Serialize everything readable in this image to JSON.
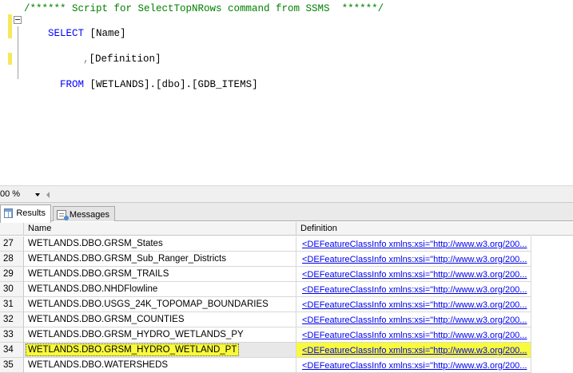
{
  "editor": {
    "comment": "/****** Script for SelectTopNRows command from SSMS  ******/",
    "line1": {
      "keyword": "SELECT",
      "rest": " [Name]"
    },
    "line2": {
      "comma": ",",
      "rest": "[Definition]"
    },
    "line3": {
      "keyword": "FROM",
      "rest": " [WETLANDS].[dbo].[GDB_ITEMS]"
    }
  },
  "zoom": {
    "value": "00 %"
  },
  "tabs": [
    {
      "label": "Results",
      "icon": "grid-icon",
      "active": true
    },
    {
      "label": "Messages",
      "icon": "messages-icon",
      "active": false
    }
  ],
  "grid": {
    "columns": [
      "Name",
      "Definition"
    ],
    "rows": [
      {
        "num": "27",
        "name": "WETLANDS.DBO.GRSM_States",
        "definition": "<DEFeatureClassInfo xmlns:xsi=\"http://www.w3.org/200..."
      },
      {
        "num": "28",
        "name": "WETLANDS.DBO.GRSM_Sub_Ranger_Districts",
        "definition": "<DEFeatureClassInfo xmlns:xsi=\"http://www.w3.org/200..."
      },
      {
        "num": "29",
        "name": "WETLANDS.DBO.GRSM_TRAILS",
        "definition": "<DEFeatureClassInfo xmlns:xsi=\"http://www.w3.org/200..."
      },
      {
        "num": "30",
        "name": "WETLANDS.DBO.NHDFlowline",
        "definition": "<DEFeatureClassInfo xmlns:xsi=\"http://www.w3.org/200..."
      },
      {
        "num": "31",
        "name": "WETLANDS.DBO.USGS_24K_TOPOMAP_BOUNDARIES",
        "definition": "<DEFeatureClassInfo xmlns:xsi=\"http://www.w3.org/200..."
      },
      {
        "num": "32",
        "name": "WETLANDS.DBO.GRSM_COUNTIES",
        "definition": "<DEFeatureClassInfo xmlns:xsi=\"http://www.w3.org/200..."
      },
      {
        "num": "33",
        "name": "WETLANDS.DBO.GRSM_HYDRO_WETLANDS_PY",
        "definition": "<DEFeatureClassInfo xmlns:xsi=\"http://www.w3.org/200..."
      },
      {
        "num": "34",
        "name": "WETLANDS.DBO.GRSM_HYDRO_WETLAND_PT",
        "definition": "<DEFeatureClassInfo xmlns:xsi=\"http://www.w3.org/200...",
        "selected": true
      },
      {
        "num": "35",
        "name": "WETLANDS.DBO.WATERSHEDS",
        "definition": "<DEFeatureClassInfo xmlns:xsi=\"http://www.w3.org/200..."
      }
    ]
  },
  "colors": {
    "highlight": "#f8fa3c",
    "keyword": "#0000ff",
    "comment": "#008000",
    "link": "#0000ee"
  }
}
